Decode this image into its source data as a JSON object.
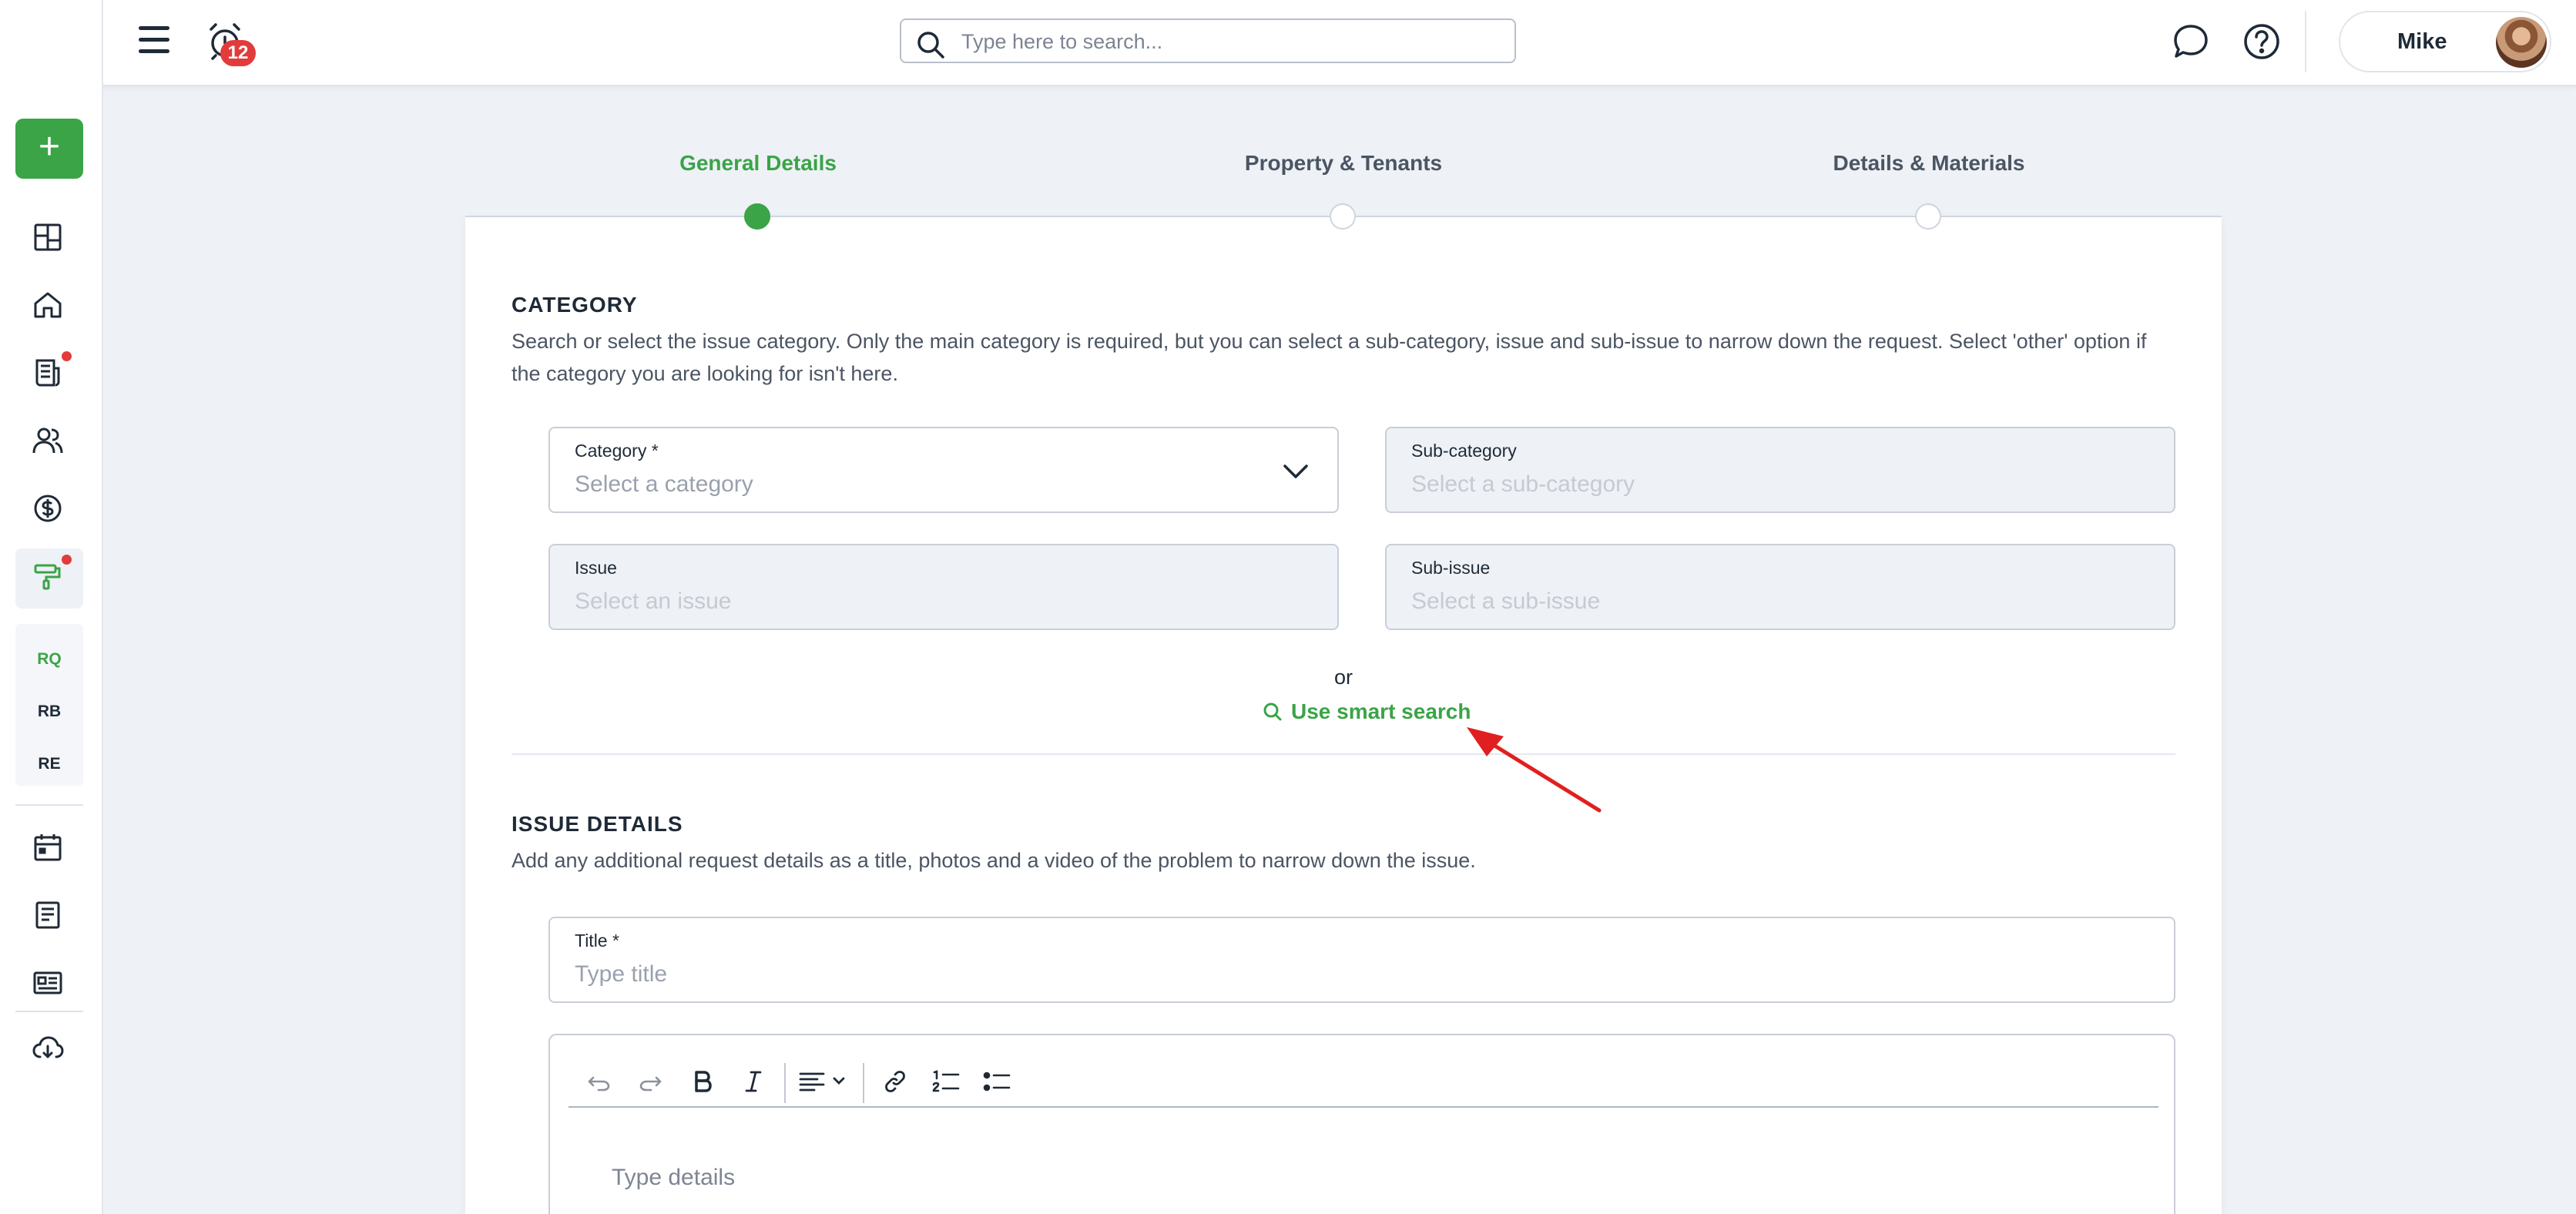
{
  "header": {
    "notifications_count": "12",
    "search_placeholder": "Type here to search...",
    "user_name": "Mike"
  },
  "sidebar": {
    "add_label": "+",
    "sub_items": [
      "RQ",
      "RB",
      "RE"
    ]
  },
  "stepper": {
    "steps": [
      "General Details",
      "Property & Tenants",
      "Details & Materials"
    ],
    "active_index": 0
  },
  "category_section": {
    "title": "CATEGORY",
    "description": "Search or select the issue category. Only the main category is required, but you can select a sub-category, issue and sub-issue to narrow down the request. Select 'other' option if the category you are looking for isn't here.",
    "fields": {
      "category": {
        "label": "Category *",
        "placeholder": "Select a category"
      },
      "sub_category": {
        "label": "Sub-category",
        "placeholder": "Select a sub-category"
      },
      "issue": {
        "label": "Issue",
        "placeholder": "Select an issue"
      },
      "sub_issue": {
        "label": "Sub-issue",
        "placeholder": "Select a sub-issue"
      }
    },
    "or_text": "or",
    "smart_search_label": "Use smart search"
  },
  "issue_section": {
    "title": "ISSUE DETAILS",
    "description": "Add any additional request details as a title, photos and a video of the problem to narrow down the issue.",
    "title_field": {
      "label": "Title *",
      "placeholder": "Type title"
    },
    "details_placeholder": "Type details"
  },
  "colors": {
    "accent_green": "#3aa447",
    "badge_red": "#e23b3b",
    "page_background": "#eef1f6"
  }
}
